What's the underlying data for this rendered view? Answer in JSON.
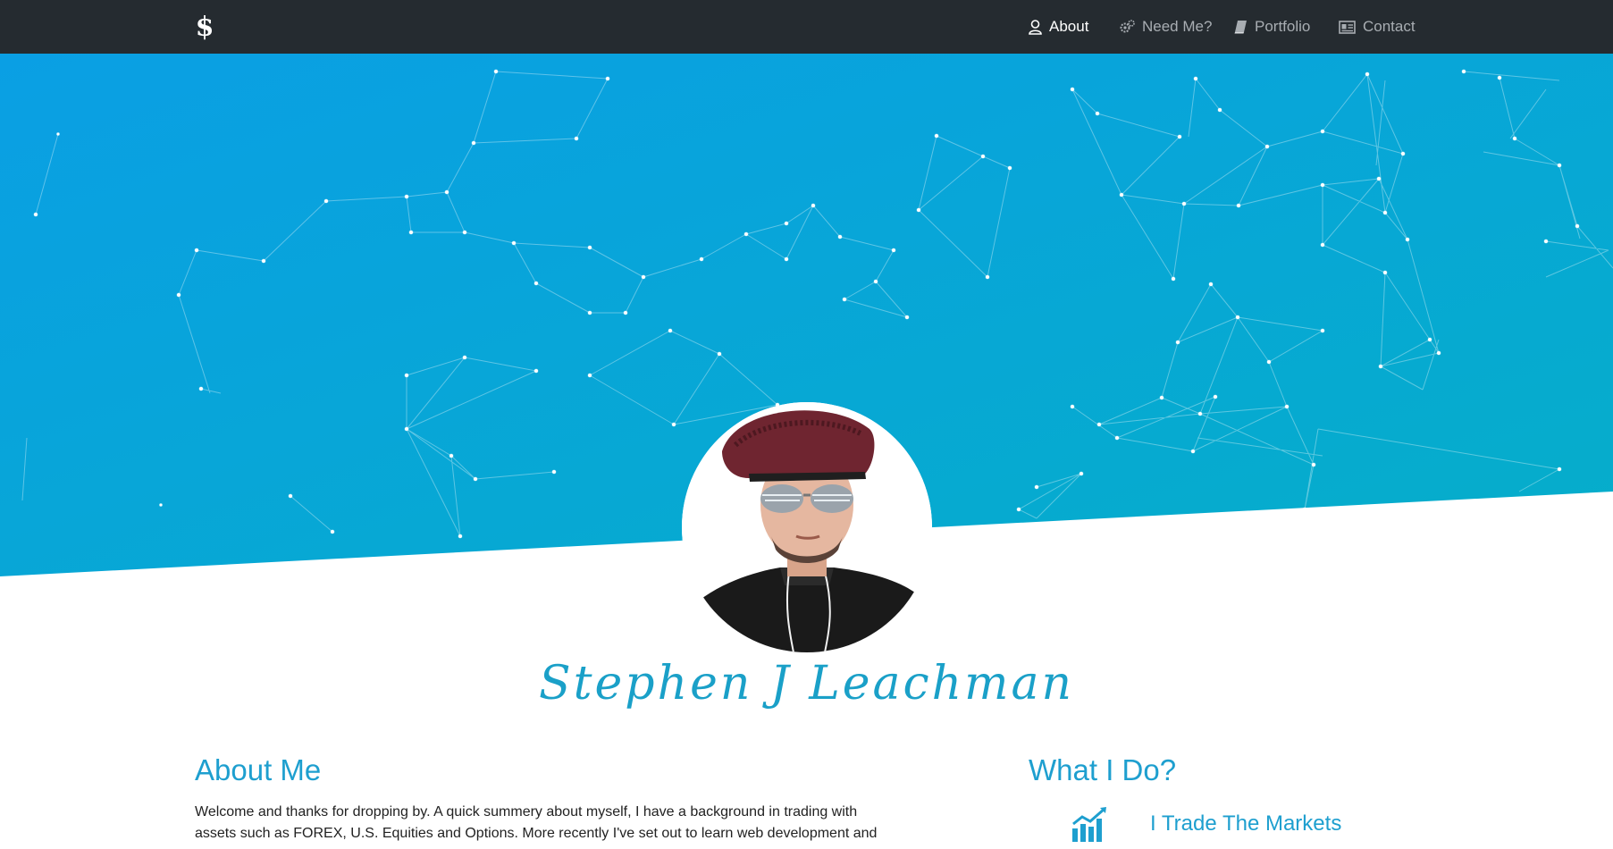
{
  "nav": {
    "brand_icon": "dollar-logo-icon",
    "items": [
      {
        "label": "About",
        "icon": "user-icon",
        "active": true
      },
      {
        "label": "Need Me?",
        "icon": "gears-icon",
        "active": false
      },
      {
        "label": "Portfolio",
        "icon": "book-icon",
        "active": false
      },
      {
        "label": "Contact",
        "icon": "id-card-icon",
        "active": false
      }
    ]
  },
  "hero": {
    "gradient_start": "#0a9fe4",
    "gradient_end": "#05aec9"
  },
  "profile": {
    "name": "Stephen J Leachman",
    "photo_icon": "profile-photo"
  },
  "about": {
    "title": "About Me",
    "text": "Welcome and thanks for dropping by. A quick summery about myself, I have a background in trading with assets such as FOREX, U.S. Equities and Options. More recently I've set out to learn web development and"
  },
  "what": {
    "title": "What I Do?",
    "items": [
      {
        "icon": "bar-chart-trend-icon",
        "title": "I Trade The Markets"
      }
    ]
  },
  "colors": {
    "accent": "#1e9fcf",
    "nav_bg": "#252b30"
  }
}
